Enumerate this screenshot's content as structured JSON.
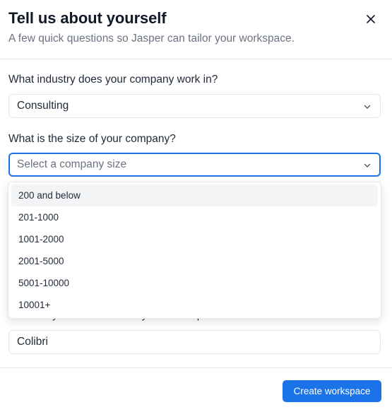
{
  "dialog": {
    "title": "Tell us about yourself",
    "subtitle": "A few quick questions so Jasper can tailor your workspace.",
    "close_icon": "close-icon"
  },
  "industry": {
    "label": "What industry does your company work in?",
    "value": "Consulting"
  },
  "company_size": {
    "label": "What is the size of your company?",
    "placeholder": "Select a company size",
    "options": [
      "200 and below",
      "201-1000",
      "1001-2000",
      "2001-5000",
      "5001-10000",
      "10001+"
    ],
    "highlighted_option": "200 and below"
  },
  "workspace": {
    "label": "What do you want to name your Workspace?",
    "value": "Colibri"
  },
  "footer": {
    "create_label": "Create workspace"
  },
  "colors": {
    "accent": "#1a73e8",
    "text": "#1f2937",
    "muted": "#6b7280",
    "border": "#e5e7eb"
  }
}
